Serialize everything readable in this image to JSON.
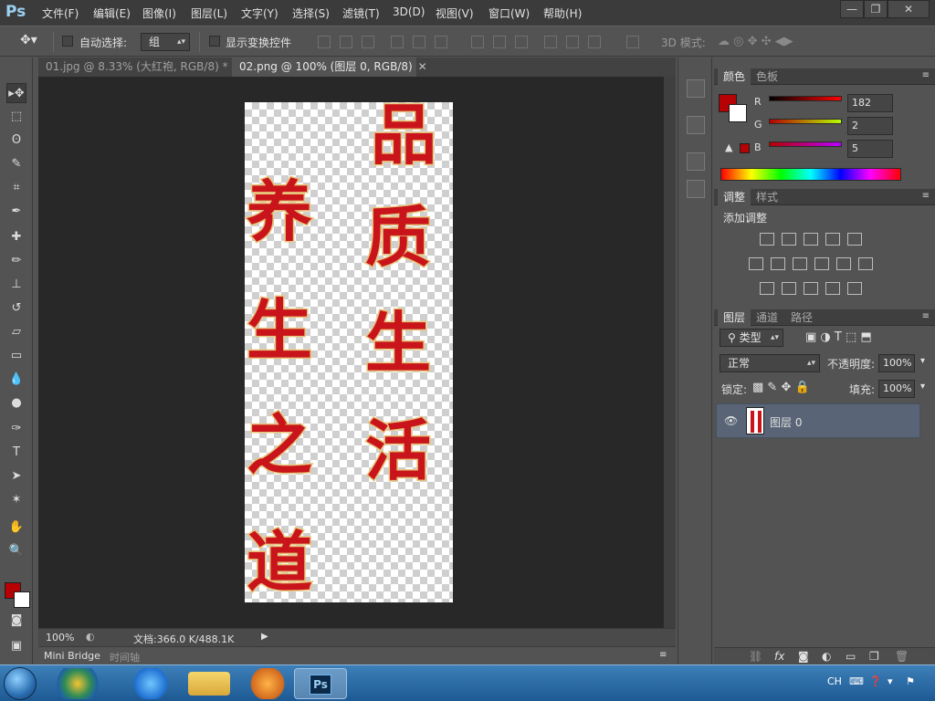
{
  "app": {
    "logo": "Ps"
  },
  "menu": [
    "文件(F)",
    "编辑(E)",
    "图像(I)",
    "图层(L)",
    "文字(Y)",
    "选择(S)",
    "滤镜(T)",
    "3D(D)",
    "视图(V)",
    "窗口(W)",
    "帮助(H)"
  ],
  "window_controls": {
    "minimize": "—",
    "restore": "❐",
    "close": "✕"
  },
  "options": {
    "auto_select_label": "自动选择:",
    "auto_select_value": "组",
    "show_transform_label": "显示变换控件",
    "mode_3d_label": "3D 模式:"
  },
  "tabs": [
    {
      "label": "01.jpg @ 8.33% (大红袍, RGB/8) *",
      "active": false
    },
    {
      "label": "02.png @ 100% (图层 0, RGB/8)",
      "active": true
    }
  ],
  "canvas_text": {
    "col_right": [
      "品",
      "质",
      "生",
      "活"
    ],
    "col_left": [
      "养",
      "生",
      "之",
      "道"
    ]
  },
  "status": {
    "zoom": "100%",
    "doc_info": "文档:366.0 K/488.1K"
  },
  "bottom_tabs": [
    "Mini Bridge",
    "时间轴"
  ],
  "color_panel": {
    "tabs": [
      "颜色",
      "色板"
    ],
    "channels": [
      {
        "name": "R",
        "value": "182"
      },
      {
        "name": "G",
        "value": "2"
      },
      {
        "name": "B",
        "value": "5"
      }
    ],
    "fg_color": "#b60205",
    "bg_color": "#ffffff"
  },
  "adjust_panel": {
    "tabs": [
      "调整",
      "样式"
    ],
    "title": "添加调整"
  },
  "layers_panel": {
    "tabs": [
      "图层",
      "通道",
      "路径"
    ],
    "filter_kind": "类型",
    "blend_mode": "正常",
    "opacity_label": "不透明度:",
    "opacity_value": "100%",
    "lock_label": "锁定:",
    "fill_label": "填充:",
    "fill_value": "100%",
    "layer_name": "图层 0",
    "footer_icons": [
      "link-icon",
      "fx",
      "mask-icon",
      "adjustment-icon",
      "folder-icon",
      "new-layer-icon",
      "trash-icon"
    ]
  },
  "taskbar": {
    "lang": "CH",
    "ps_label": "Ps"
  },
  "colors": {
    "accent": "#c8141a",
    "outline": "#e8c57c"
  }
}
